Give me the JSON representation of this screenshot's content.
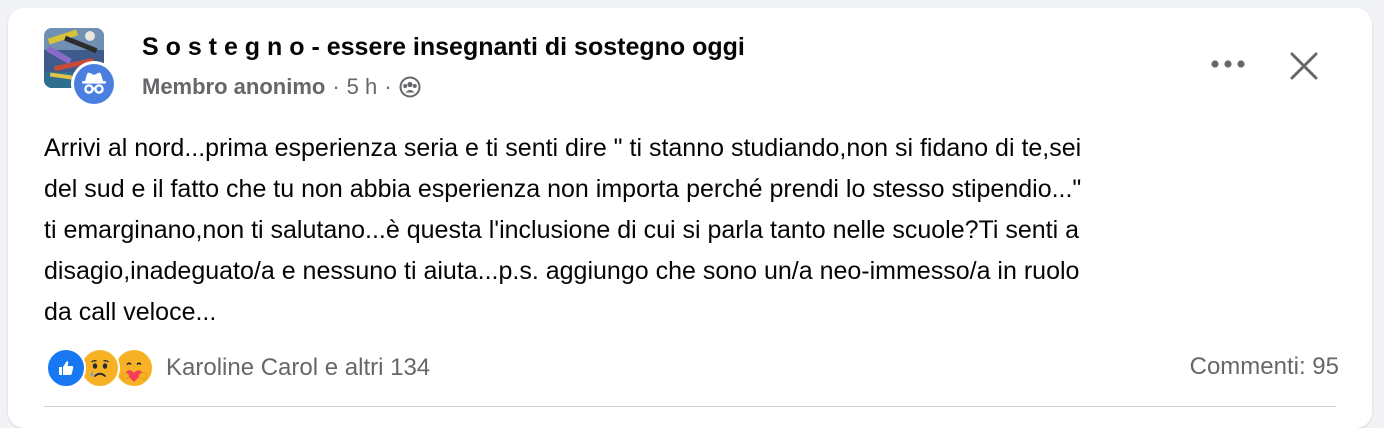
{
  "post": {
    "group_name": "S o s t e g n o - essere insegnanti di sostegno oggi",
    "author": "Membro anonimo",
    "separator": "·",
    "time": "5 h",
    "audience_icon": "group-audience-icon",
    "body": "Arrivi al nord...prima esperienza seria e ti senti dire \" ti stanno studiando,non si fidano di te,sei\ndel sud e il fatto che tu non abbia esperienza non importa perché prendi lo stesso stipendio...\"\nti emarginano,non ti salutano...è questa l'inclusione di cui si parla tanto nelle scuole?Ti senti a\ndisagio,inadeguato/a e nessuno ti aiuta...p.s. aggiungo che sono un/a neo-immesso/a in ruolo\nda call veloce..."
  },
  "header_actions": {
    "more_icon": "more-options-icon",
    "close_icon": "close-icon"
  },
  "footer": {
    "reaction_icons": [
      "like-icon",
      "sad-icon",
      "care-icon"
    ],
    "reactions_label": "Karoline Carol e altri 134",
    "comments_label": "Commenti: 95"
  },
  "colors": {
    "like_blue": "#1877f2",
    "secondary_text": "#65676b",
    "primary_text": "#050505",
    "emoji_yellow": "#f7b125",
    "heart_red": "#f33e58"
  }
}
